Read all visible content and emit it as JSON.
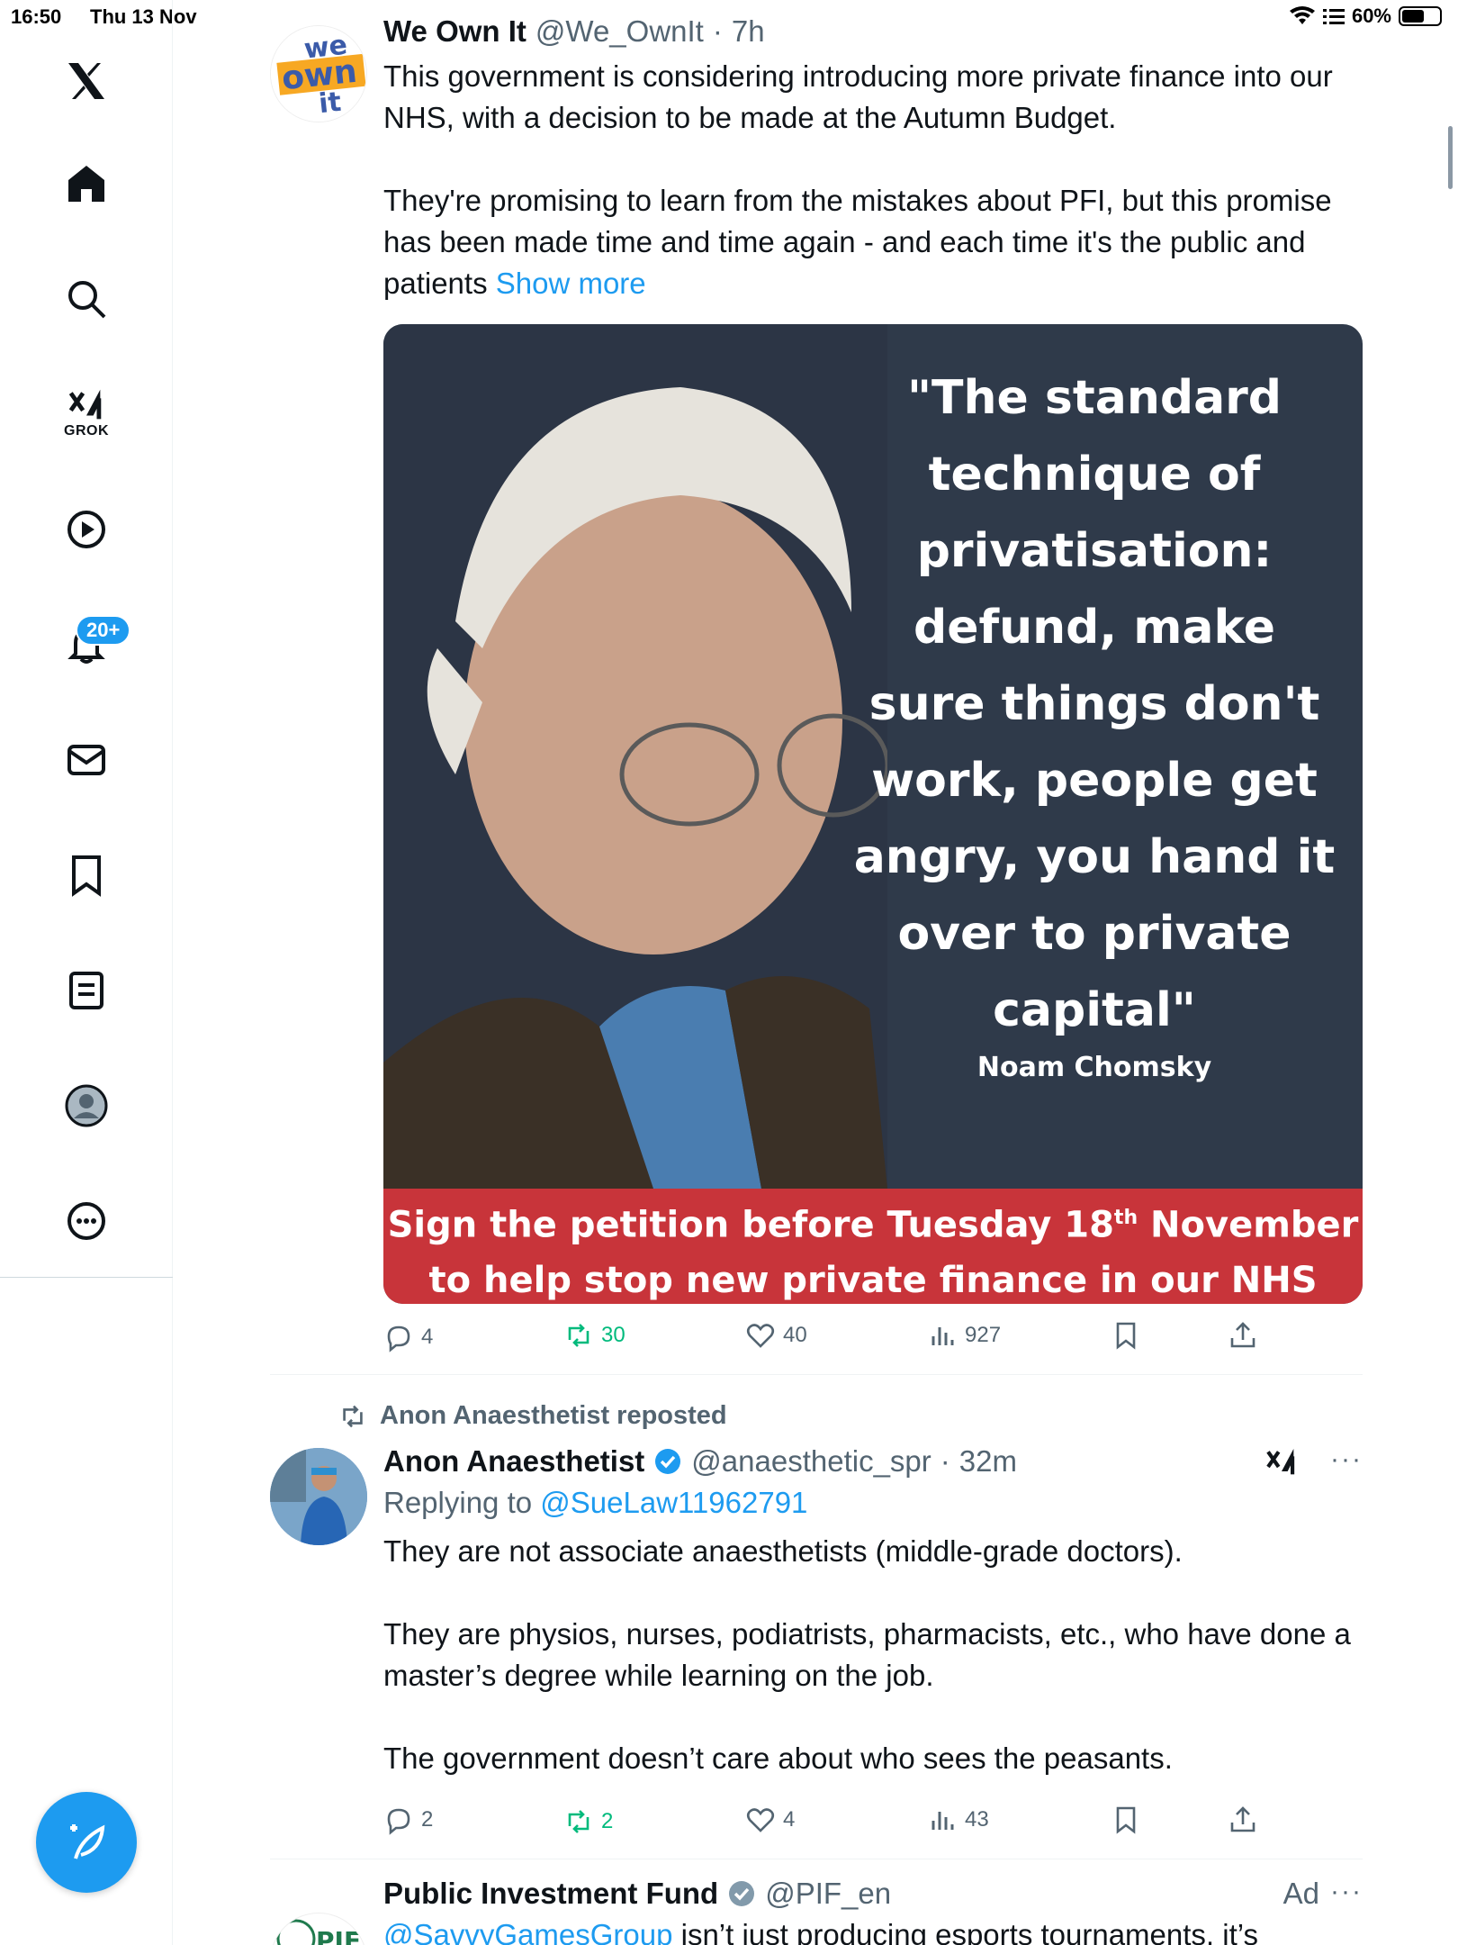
{
  "status_bar": {
    "time": "16:50",
    "date": "Thu 13 Nov",
    "battery": "60%",
    "battery_level": 0.6
  },
  "sidebar": {
    "grok_label": "GROK",
    "notifications_badge": "20+"
  },
  "tweets": [
    {
      "name": "We Own It",
      "handle": "@We_OwnIt",
      "dot": "·",
      "time": "7h",
      "avatar_text": "we own it",
      "text": "This government is considering introducing more private finance into our NHS, with a decision to be made at the Autumn Budget.\n\nThey're promising to learn from the mistakes about PFI, but this promise has been made time and time again - and each time it's the public and patients ",
      "show_more": "Show more",
      "image": {
        "quote": "\"The standard technique of privatisation: defund, make sure things don't work, people get angry, you hand it over to private capital\"",
        "author": "Noam Chomsky",
        "banner_line1_a": "Sign the petition before Tuesday 18",
        "banner_sup": "th",
        "banner_line1_b": " November",
        "banner_line2": "to help stop new private finance in our NHS"
      },
      "stats": {
        "replies": "4",
        "reposts": "30",
        "likes": "40",
        "views": "927"
      }
    },
    {
      "repost_label": "Anon Anaesthetist reposted",
      "name": "Anon Anaesthetist",
      "handle": "@anaesthetic_spr",
      "dot": "·",
      "time": "32m",
      "replying_prefix": "Replying to ",
      "replying_to": "@SueLaw11962791",
      "text": "They are not associate anaesthetists (middle-grade doctors).\n\nThey are physios, nurses, podiatrists, pharmacists, etc., who have done a master’s degree while learning on the job.\n\nThe government doesn’t care about who sees the peasants.",
      "stats": {
        "replies": "2",
        "reposts": "2",
        "likes": "4",
        "views": "43"
      },
      "more": "···"
    },
    {
      "name": "Public Investment Fund",
      "handle": "@PIF_en",
      "ad_label": "Ad",
      "avatar_text": "PIF",
      "text_link": "@SavvyGamesGroup",
      "text_rest": " isn’t just producing esports tournaments, it’s",
      "more": "···"
    }
  ],
  "colors": {
    "accent": "#1d9bf0",
    "repost_green": "#00ba7c",
    "muted": "#536471",
    "banner_red": "#c8343a",
    "quote_bg": "#2f3a4a"
  }
}
